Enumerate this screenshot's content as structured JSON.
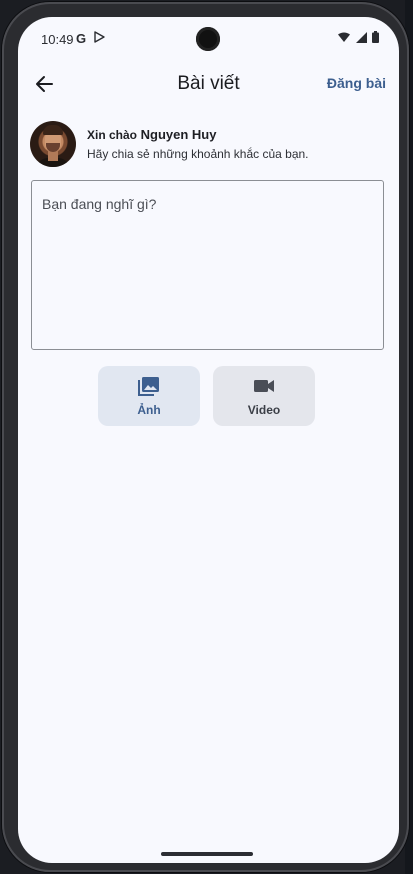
{
  "status_bar": {
    "time": "10:49",
    "google_label": "G"
  },
  "app_bar": {
    "title": "Bài viết",
    "post_label": "Đăng bài"
  },
  "user": {
    "greeting": "Xin chào",
    "name": "Nguyen Huy",
    "subtitle": "Hãy chia sẻ những khoảnh khắc của bạn."
  },
  "composer": {
    "placeholder": "Bạn đang nghĩ gì?"
  },
  "media": {
    "photo_label": "Ảnh",
    "video_label": "Video"
  },
  "colors": {
    "accent": "#3d5f8f",
    "background": "#f8f9fe",
    "photo_button_bg": "#e1e7f1",
    "video_button_bg": "#e4e6ec"
  },
  "icons": {
    "back": "arrow-left-icon",
    "photo": "photo-library-icon",
    "video": "videocam-icon"
  }
}
